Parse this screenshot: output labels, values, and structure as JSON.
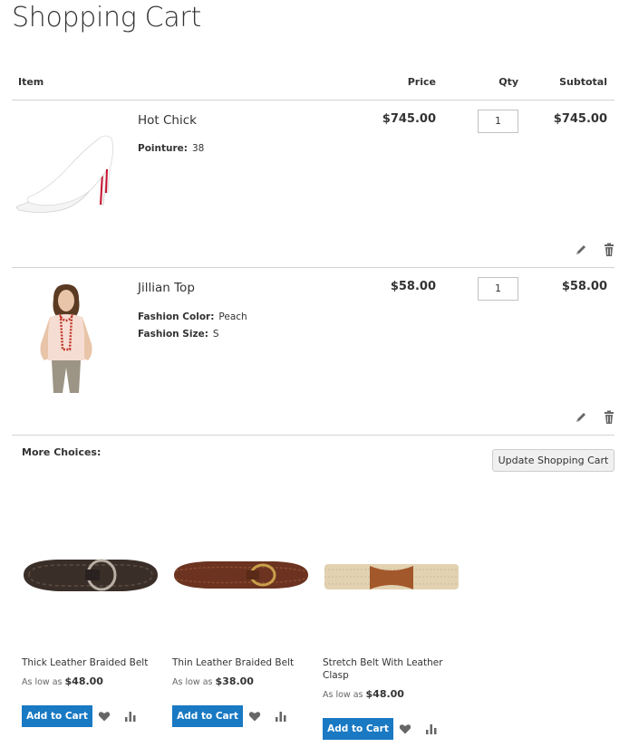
{
  "page": {
    "title": "Shopping Cart"
  },
  "columns": {
    "item": "Item",
    "price": "Price",
    "qty": "Qty",
    "subtotal": "Subtotal"
  },
  "items": [
    {
      "name": "Hot Chick",
      "image_icon": "pump-shoe-image",
      "options": [
        {
          "label": "Pointure:",
          "value": "38"
        }
      ],
      "price": "$745.00",
      "qty": "1",
      "subtotal": "$745.00"
    },
    {
      "name": "Jillian Top",
      "image_icon": "top-model-image",
      "options": [
        {
          "label": "Fashion Color:",
          "value": "Peach"
        },
        {
          "label": "Fashion Size:",
          "value": "S"
        }
      ],
      "price": "$58.00",
      "qty": "1",
      "subtotal": "$58.00"
    }
  ],
  "more_choices": {
    "label": "More Choices:",
    "update_label": "Update Shopping Cart",
    "products": [
      {
        "name": "Thick Leather Braided Belt",
        "as_low": "As low as",
        "price": "$48.00",
        "add_label": "Add to Cart"
      },
      {
        "name": "Thin Leather Braided Belt",
        "as_low": "As low as",
        "price": "$38.00",
        "add_label": "Add to Cart"
      },
      {
        "name": "Stretch Belt With Leather Clasp",
        "as_low": "As low as",
        "price": "$48.00",
        "add_label": "Add to Cart"
      }
    ]
  },
  "colors": {
    "accent": "#1979c3",
    "border": "#d1d1d1",
    "text": "#333333"
  }
}
